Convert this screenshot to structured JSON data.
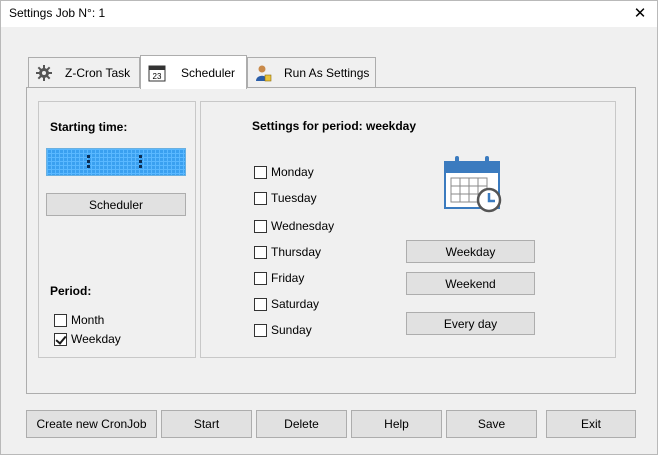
{
  "window": {
    "title": "Settings Job N°: 1",
    "close_glyph": "✕"
  },
  "tabs": [
    {
      "label": "Z-Cron Task",
      "icon": "gear-icon"
    },
    {
      "label": "Scheduler",
      "icon": "calendar-icon",
      "icon_text": "23",
      "active": true
    },
    {
      "label": "Run As Settings",
      "icon": "user-icon"
    }
  ],
  "left": {
    "starting_time_label": "Starting time:",
    "scheduler_button": "Scheduler",
    "period_label": "Period:",
    "period_options": [
      {
        "label": "Month",
        "checked": false
      },
      {
        "label": "Weekday",
        "checked": true
      }
    ]
  },
  "right": {
    "heading": "Settings for period: weekday",
    "days": [
      {
        "label": "Monday",
        "checked": false
      },
      {
        "label": "Tuesday",
        "checked": false
      },
      {
        "label": "Wednesday",
        "checked": false
      },
      {
        "label": "Thursday",
        "checked": false
      },
      {
        "label": "Friday",
        "checked": false
      },
      {
        "label": "Saturday",
        "checked": false
      },
      {
        "label": "Sunday",
        "checked": false
      }
    ],
    "buttons": {
      "weekday": "Weekday",
      "weekend": "Weekend",
      "every_day": "Every day"
    }
  },
  "footer": {
    "create": "Create new CronJob",
    "start": "Start",
    "delete": "Delete",
    "help": "Help",
    "save": "Save",
    "exit": "Exit"
  },
  "colors": {
    "lcd": "#3aa0f0",
    "calendar_accent": "#3b7bbf"
  }
}
